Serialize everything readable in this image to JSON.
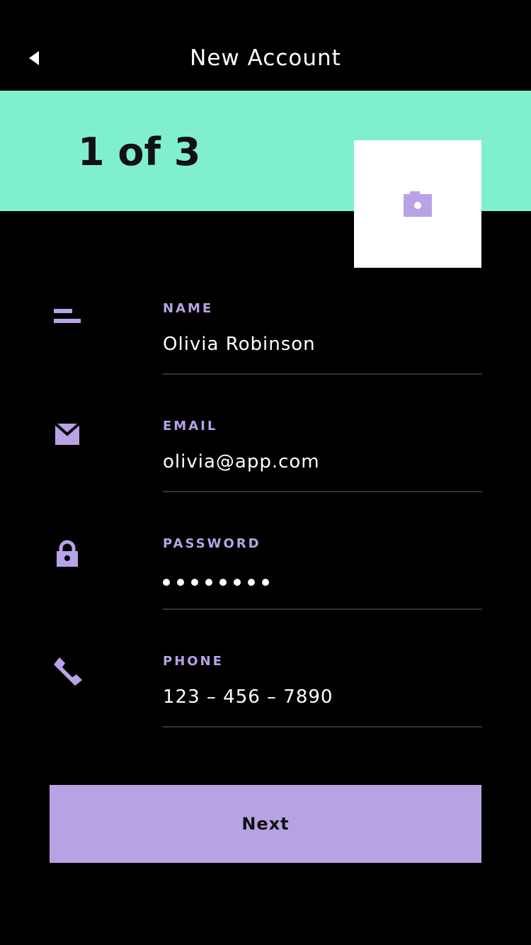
{
  "header": {
    "title": "New Account",
    "back_icon": "back-arrow-icon"
  },
  "banner": {
    "step_text": "1 of 3",
    "photo_icon": "camera-icon"
  },
  "fields": [
    {
      "label": "NAME",
      "value": "Olivia Robinson",
      "icon": "name-icon"
    },
    {
      "label": "EMAIL",
      "value": "olivia@app.com",
      "icon": "mail-icon"
    },
    {
      "label": "PASSWORD",
      "masked_length": 8,
      "icon": "lock-icon"
    },
    {
      "label": "PHONE",
      "value": "123 – 456 – 7890",
      "icon": "phone-icon"
    }
  ],
  "actions": {
    "next_label": "Next"
  },
  "colors": {
    "background": "#000000",
    "banner": "#80efcf",
    "accent": "#b7a3e6",
    "button": "#b7a3e3",
    "divider": "#333333"
  }
}
